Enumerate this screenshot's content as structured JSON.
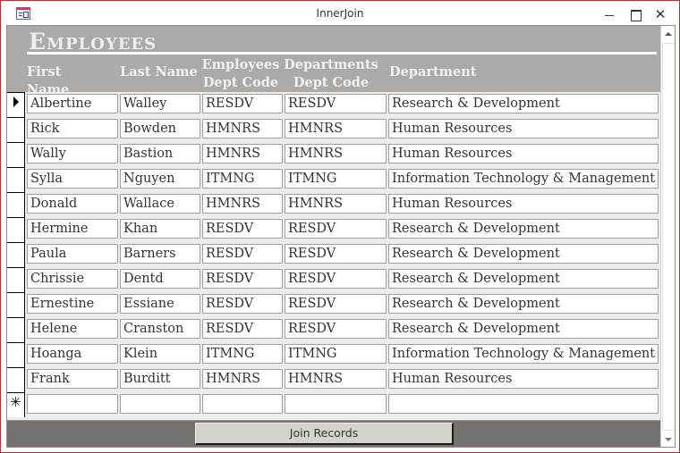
{
  "window": {
    "title": "InnerJoin",
    "icons": {
      "app": "form-icon",
      "minimize": "minimize-icon",
      "maximize": "maximize-icon",
      "close": "close-icon"
    },
    "close_glyph": "✕"
  },
  "form": {
    "title": "Employees",
    "columns": [
      {
        "line1": "First Name",
        "line2": ""
      },
      {
        "line1": "Last Name",
        "line2": ""
      },
      {
        "line1": "Employees",
        "line2": "Dept Code"
      },
      {
        "line1": "Departments",
        "line2": "Dept Code"
      },
      {
        "line1": "Department",
        "line2": ""
      }
    ],
    "records": [
      [
        "Albertine",
        "Walley",
        "RESDV",
        "RESDV",
        "Research & Development"
      ],
      [
        "Rick",
        "Bowden",
        "HMNRS",
        "HMNRS",
        "Human Resources"
      ],
      [
        "Wally",
        "Bastion",
        "HMNRS",
        "HMNRS",
        "Human Resources"
      ],
      [
        "Sylla",
        "Nguyen",
        "ITMNG",
        "ITMNG",
        "Information Technology & Management"
      ],
      [
        "Donald",
        "Wallace",
        "HMNRS",
        "HMNRS",
        "Human Resources"
      ],
      [
        "Hermine",
        "Khan",
        "RESDV",
        "RESDV",
        "Research & Development"
      ],
      [
        "Paula",
        "Barners",
        "RESDV",
        "RESDV",
        "Research & Development"
      ],
      [
        "Chrissie",
        "Dentd",
        "RESDV",
        "RESDV",
        "Research & Development"
      ],
      [
        "Ernestine",
        "Essiane",
        "RESDV",
        "RESDV",
        "Research & Development"
      ],
      [
        "Helene",
        "Cranston",
        "RESDV",
        "RESDV",
        "Research & Development"
      ],
      [
        "Hoanga",
        "Klein",
        "ITMNG",
        "ITMNG",
        "Information Technology & Management"
      ],
      [
        "Frank",
        "Burditt",
        "HMNRS",
        "HMNRS",
        "Human Resources"
      ]
    ],
    "new_record": [
      "",
      "",
      "",
      "",
      ""
    ],
    "current_record_index": 0,
    "new_record_glyph": "✳"
  },
  "footer": {
    "join_button_label": "Join Records"
  },
  "colors": {
    "header_bg": "#aca9a6",
    "footer_bg": "#75716f",
    "window_border": "#a33a3a"
  }
}
